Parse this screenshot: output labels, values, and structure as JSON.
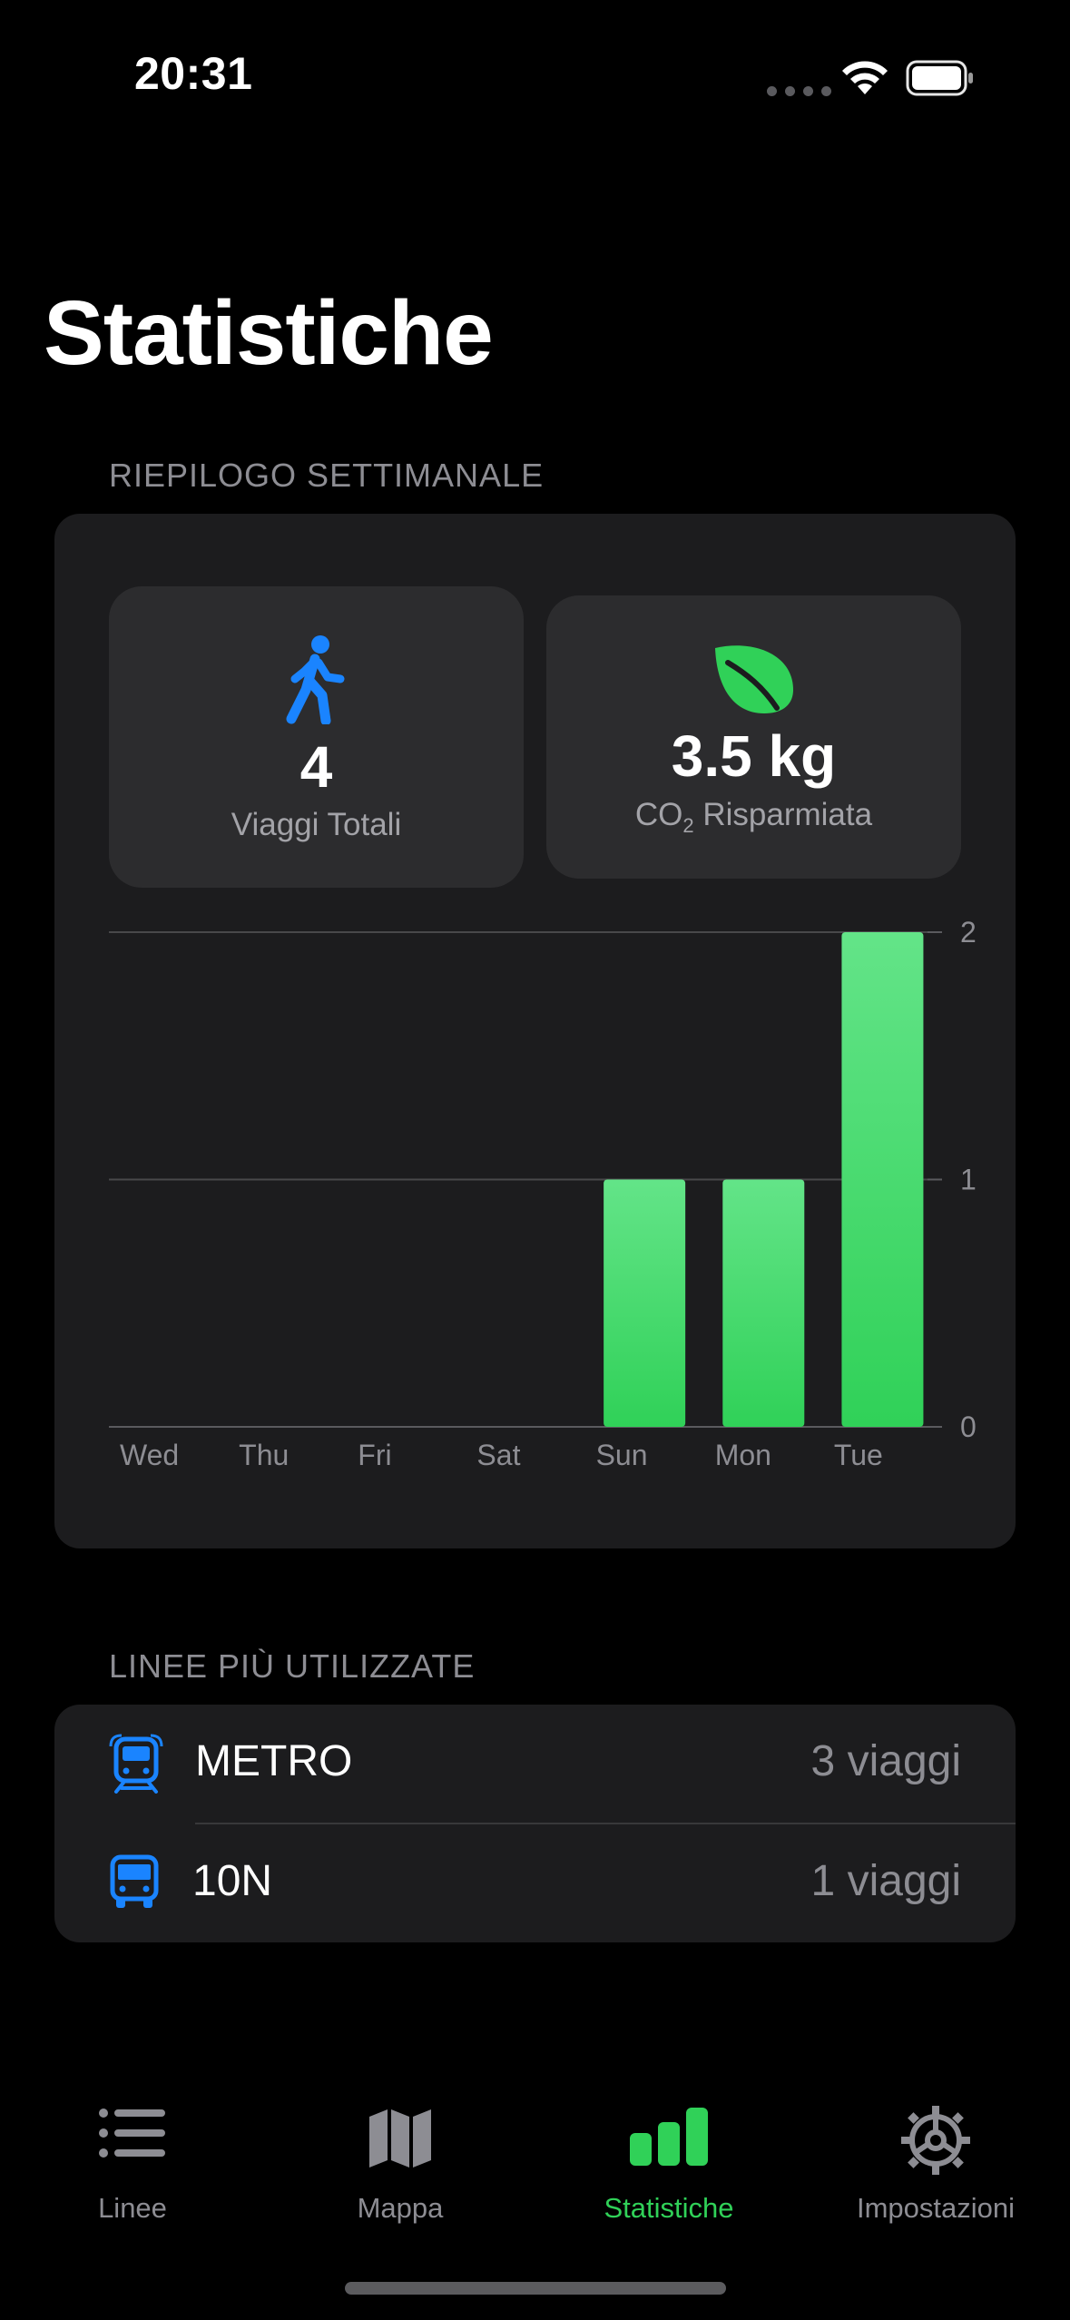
{
  "status_bar": {
    "time": "20:31"
  },
  "header": {
    "title": "Statistiche"
  },
  "weekly": {
    "section_label": "RIEPILOGO SETTIMANALE",
    "trips": {
      "value": "4",
      "label": "Viaggi Totali",
      "icon": "walk-icon"
    },
    "co2": {
      "value": "3.5 kg",
      "label_main": "CO",
      "label_sub": "2",
      "label_rest": " Risparmiata",
      "icon": "leaf-icon"
    }
  },
  "chart_data": {
    "type": "bar",
    "categories": [
      "Wed",
      "Thu",
      "Fri",
      "Sat",
      "Sun",
      "Mon",
      "Tue"
    ],
    "values": [
      0,
      0,
      0,
      0,
      1,
      1,
      2
    ],
    "ylim": [
      0,
      2
    ],
    "yticks": [
      "0",
      "1",
      "2"
    ],
    "grid": true,
    "color_top": "#63e488",
    "color_bottom": "#30d158"
  },
  "lines": {
    "section_label": "LINEE PIÙ UTILIZZATE",
    "items": [
      {
        "name": "METRO",
        "count": "3 viaggi",
        "icon": "tram-icon"
      },
      {
        "name": "10N",
        "count": "1 viaggi",
        "icon": "bus-icon"
      }
    ]
  },
  "tabbar": {
    "tabs": [
      {
        "label": "Linee",
        "icon": "list-icon"
      },
      {
        "label": "Mappa",
        "icon": "map-icon"
      },
      {
        "label": "Statistiche",
        "icon": "chart-bar-icon",
        "active": true
      },
      {
        "label": "Impostazioni",
        "icon": "gear-icon"
      }
    ]
  },
  "colors": {
    "accent": "#30d158",
    "icon_blue": "#1a84ff",
    "card": "#1c1c1e",
    "tile": "#2c2c2e"
  }
}
